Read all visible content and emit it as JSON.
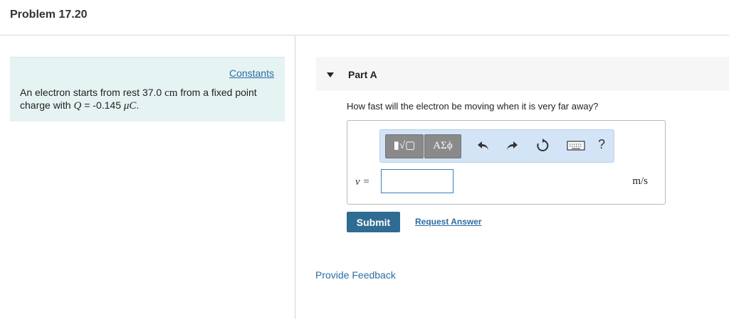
{
  "problem": {
    "title": "Problem 17.20"
  },
  "info": {
    "constants_label": "Constants",
    "text_before_value": "An electron starts from rest 37.0",
    "distance_unit": "cm",
    "text_middle": "from a fixed point charge with",
    "charge_symbol": "Q",
    "equals": "=",
    "charge_value": "-0.145",
    "charge_unit": "μC",
    "period": "."
  },
  "part": {
    "arrow_icon": "triangle-down",
    "title": "Part A",
    "question": "How fast will the electron be moving when it is very far away?"
  },
  "toolbar": {
    "templates_label": "▮√▢",
    "symbols_label": "ΑΣϕ",
    "undo_icon": "undo-arrow",
    "redo_icon": "redo-arrow",
    "reset_icon": "reset-circle",
    "keyboard_icon": "keyboard",
    "help_label": "?"
  },
  "answer": {
    "variable_label": "v =",
    "value": "",
    "unit": "m/s"
  },
  "actions": {
    "submit_label": "Submit",
    "request_answer_label": "Request Answer"
  },
  "footer": {
    "feedback_label": "Provide Feedback"
  },
  "colors": {
    "info_bg": "#e6f3f3",
    "link": "#2c6ea3",
    "submit_bg": "#2f6c92",
    "toolbar_bg": "#d3e4f7"
  }
}
